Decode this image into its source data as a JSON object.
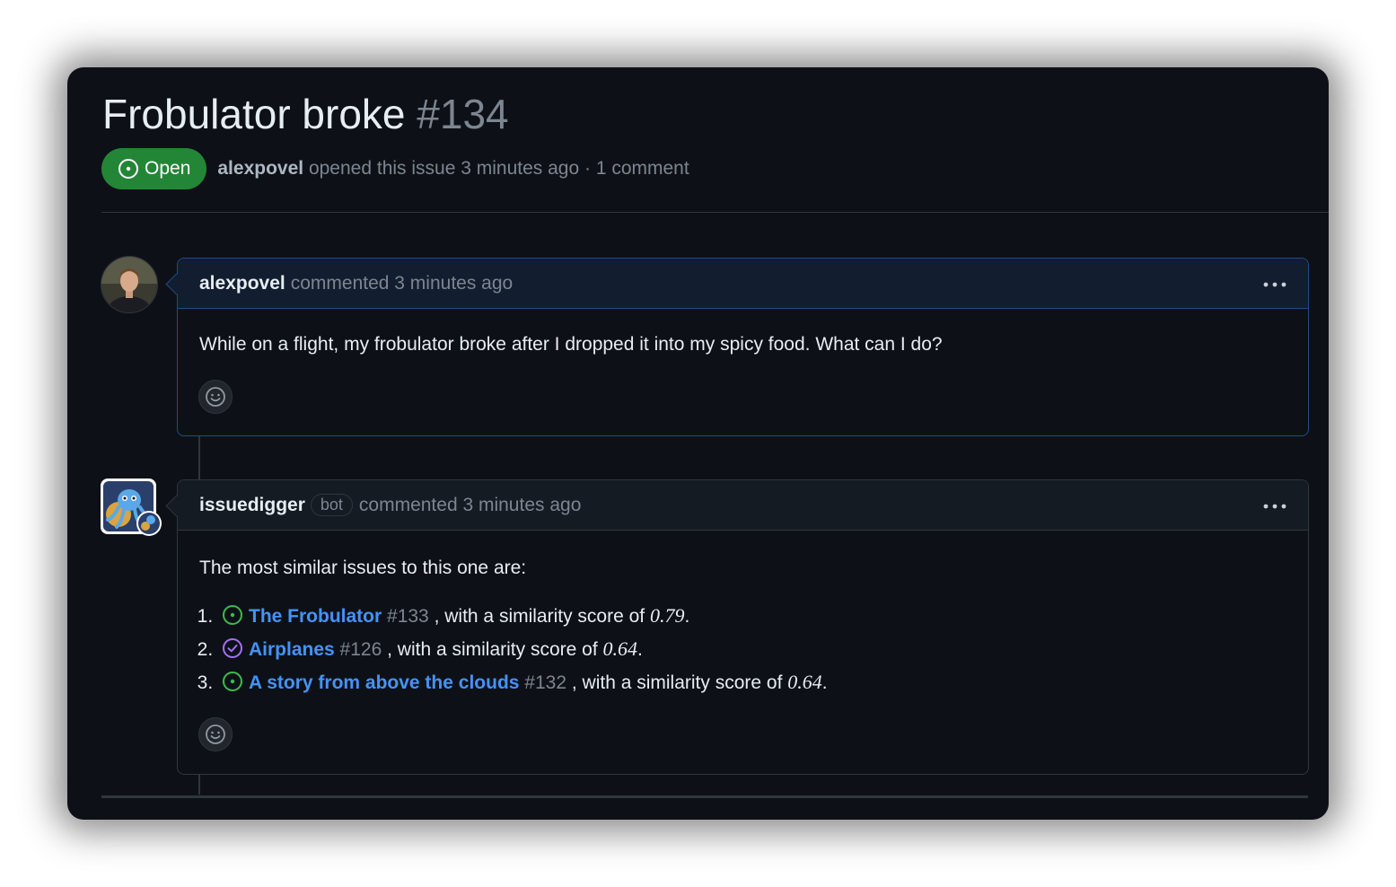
{
  "issue": {
    "title": "Frobulator broke",
    "number": "#134",
    "state_label": "Open",
    "author": "alexpovel",
    "meta_text": "opened this issue 3 minutes ago · 1 comment"
  },
  "comments": [
    {
      "author": "alexpovel",
      "action": "commented 3 minutes ago",
      "body": "While on a flight, my frobulator broke after I dropped it into my spicy food. What can I do?"
    },
    {
      "author": "issuedigger",
      "badge": "bot",
      "action": "commented 3 minutes ago",
      "intro": "The most similar issues to this one are:",
      "items": [
        {
          "title": "The Frobulator",
          "ref": "#133",
          "text": ", with a similarity score of ",
          "score": "0.79",
          "state": "open"
        },
        {
          "title": "Airplanes",
          "ref": "#126",
          "text": ", with a similarity score of ",
          "score": "0.64",
          "state": "closed"
        },
        {
          "title": "A story from above the clouds",
          "ref": "#132",
          "text": ", with a similarity score of ",
          "score": "0.64",
          "state": "open"
        }
      ]
    }
  ],
  "colors": {
    "open_green": "#238636",
    "open_icon": "#3fb950",
    "closed_purple": "#a371f7",
    "link_blue": "#4493f8"
  },
  "icons": {
    "state": "issue-opened-icon",
    "menu": "kebab-horizontal-icon",
    "reaction": "smiley-icon"
  }
}
